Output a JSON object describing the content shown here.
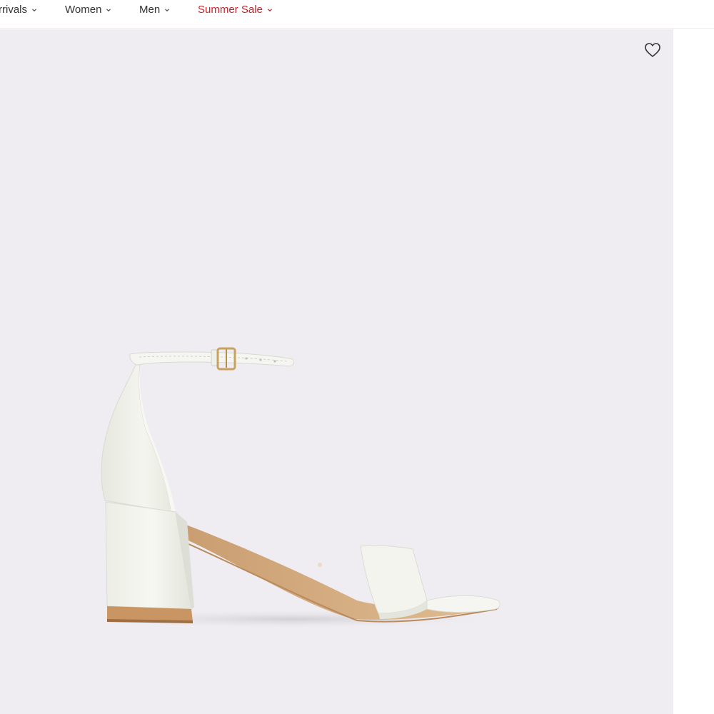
{
  "nav": {
    "items": [
      {
        "label": "rrivals"
      },
      {
        "label": "Women"
      },
      {
        "label": "Men"
      },
      {
        "label": "Summer Sale"
      }
    ]
  },
  "product": {
    "image_icon": "block-heel-ankle-strap-sandal",
    "wishlist_icon": "heart-outline-icon"
  },
  "colors": {
    "sale": "#c8242a",
    "gallery_bg": "#efedf1",
    "nav_text": "#333333"
  }
}
